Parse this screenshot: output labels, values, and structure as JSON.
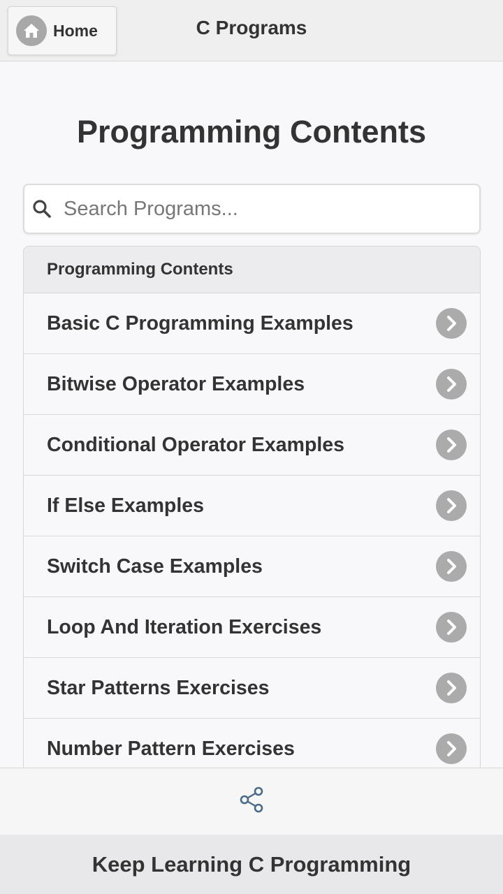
{
  "header": {
    "home_label": "Home",
    "home_icon": "home-icon",
    "title": "C Programs"
  },
  "page": {
    "title": "Programming Contents"
  },
  "search": {
    "placeholder": "Search Programs...",
    "value": "",
    "icon": "search-icon"
  },
  "list": {
    "header": "Programming Contents",
    "items": [
      {
        "label": "Basic C Programming Examples"
      },
      {
        "label": "Bitwise Operator Examples"
      },
      {
        "label": "Conditional Operator Examples"
      },
      {
        "label": "If Else Examples"
      },
      {
        "label": "Switch Case Examples"
      },
      {
        "label": "Loop And Iteration Exercises"
      },
      {
        "label": "Star Patterns Exercises"
      },
      {
        "label": "Number Pattern Exercises"
      }
    ],
    "item_icon": "chevron-right-icon"
  },
  "share": {
    "icon": "share-icon"
  },
  "footer": {
    "text": "Keep Learning C Programming"
  },
  "colors": {
    "icon_bg": "#ababab",
    "text": "#333333",
    "header_bg": "#efeff0",
    "page_bg": "#f8f8fa",
    "share_icon": "#4a6a86"
  }
}
